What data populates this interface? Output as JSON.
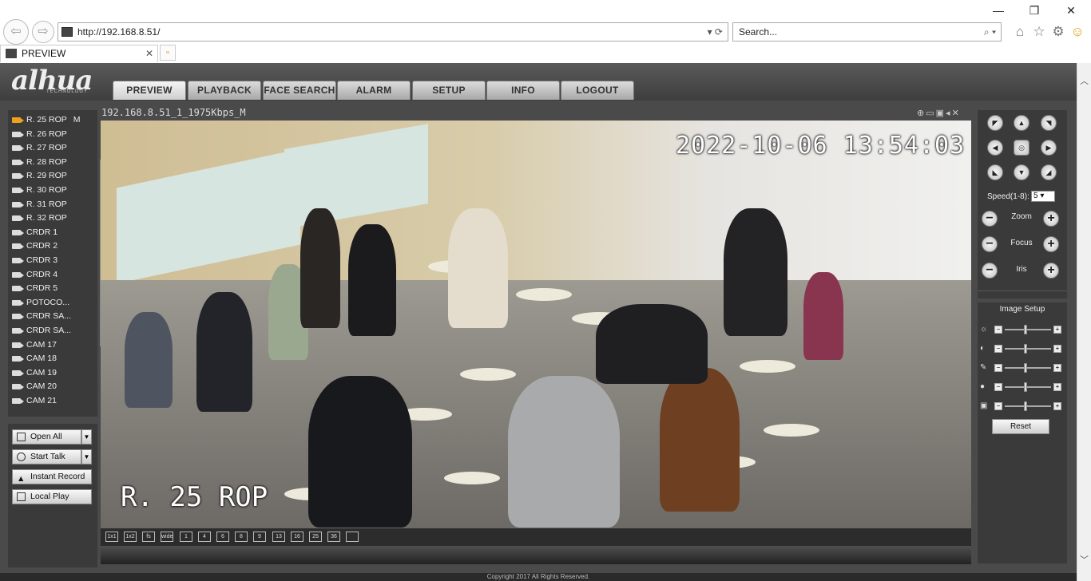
{
  "browser": {
    "url": "http://192.168.8.51/",
    "search_placeholder": "Search...",
    "tab_title": "PREVIEW"
  },
  "app": {
    "logo": "alhua",
    "logo_sub": "TECHNOLOGY",
    "menu": [
      "PREVIEW",
      "PLAYBACK",
      "FACE SEARCH",
      "ALARM",
      "SETUP",
      "INFO",
      "LOGOUT"
    ],
    "active_menu": "PREVIEW"
  },
  "cameras": [
    {
      "label": "R. 25 ROP",
      "suffix": "M",
      "active": true
    },
    {
      "label": "R. 26 ROP"
    },
    {
      "label": "R. 27 ROP"
    },
    {
      "label": "R. 28 ROP"
    },
    {
      "label": "R. 29 ROP"
    },
    {
      "label": "R. 30 ROP"
    },
    {
      "label": "R. 31 ROP"
    },
    {
      "label": "R. 32 ROP"
    },
    {
      "label": "CRDR 1"
    },
    {
      "label": "CRDR 2"
    },
    {
      "label": "CRDR 3"
    },
    {
      "label": "CRDR 4"
    },
    {
      "label": "CRDR 5"
    },
    {
      "label": "POTOCO..."
    },
    {
      "label": "CRDR SA..."
    },
    {
      "label": "CRDR SA..."
    },
    {
      "label": "CAM 17"
    },
    {
      "label": "CAM 18"
    },
    {
      "label": "CAM 19"
    },
    {
      "label": "CAM 20"
    },
    {
      "label": "CAM 21"
    }
  ],
  "controls": {
    "open_all": "Open All",
    "start_talk": "Start Talk",
    "instant_record": "Instant Record",
    "local_play": "Local Play"
  },
  "video": {
    "title": "192.168.8.51_1_1975Kbps_M",
    "timestamp": "2022-10-06 13:54:03",
    "osd_name": "R. 25 ROP"
  },
  "layout_buttons": [
    "1x1",
    "1x2",
    "fs",
    "wide",
    "1",
    "4",
    "6",
    "8",
    "9",
    "13",
    "16",
    "25",
    "36"
  ],
  "ptz": {
    "speed_label": "Speed(1-8):",
    "speed_value": "5",
    "zoom_label": "Zoom",
    "focus_label": "Focus",
    "iris_label": "Iris"
  },
  "image_setup": {
    "title": "Image Setup",
    "rows": [
      "brightness",
      "contrast",
      "saturation",
      "hue",
      "gain"
    ],
    "reset_label": "Reset"
  },
  "footer": "Copyright 2017 All Rights Reserved."
}
